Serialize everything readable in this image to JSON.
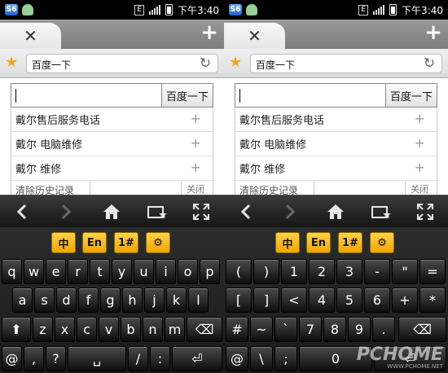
{
  "status_bar": {
    "app_badge": "S6",
    "network": "E",
    "time": "下午3:40"
  },
  "tab_strip": {
    "close_glyph": "✕",
    "add_glyph": "+"
  },
  "url_bar": {
    "value": "百度一下"
  },
  "search": {
    "value": "",
    "button_label": "百度一下"
  },
  "suggestions": [
    {
      "text": "戴尔售后服务电话"
    },
    {
      "text": "戴尔 电脑维修"
    },
    {
      "text": "戴尔 维修"
    }
  ],
  "suggestion_footer": {
    "clear_history": "清除历史记录",
    "close": "关闭"
  },
  "nav_bar": {
    "back": "back-icon",
    "forward": "forward-icon",
    "home": "home-icon",
    "bookmarks": "bookmarks-icon",
    "fullscreen": "fullscreen-icon"
  },
  "keyboard_left": {
    "mode_keys": [
      "中",
      "En",
      "1#",
      "⚙"
    ],
    "row1": [
      "q",
      "w",
      "e",
      "r",
      "t",
      "y",
      "u",
      "i",
      "o",
      "p"
    ],
    "row2": [
      "a",
      "s",
      "d",
      "f",
      "g",
      "h",
      "j",
      "k",
      "l"
    ],
    "row3": [
      "⬆",
      "z",
      "x",
      "c",
      "v",
      "b",
      "n",
      "m",
      "⌫"
    ],
    "row4": [
      "@",
      ",",
      "?",
      "␣",
      "/",
      ":",
      "⏎"
    ]
  },
  "keyboard_right": {
    "mode_keys": [
      "中",
      "En",
      "1#",
      "⚙"
    ],
    "row1": [
      "(",
      ")",
      "1",
      "2",
      "3",
      "-",
      "\"",
      "="
    ],
    "row2": [
      "[",
      "]",
      "<",
      "4",
      "5",
      "6",
      "+",
      "*"
    ],
    "row3": [
      "#",
      "~",
      "`",
      "7",
      "8",
      "9",
      ".",
      "⌫"
    ],
    "row4": [
      "@",
      "\\",
      ";",
      "0",
      "⏎"
    ]
  },
  "watermark": {
    "text": "PCHOME",
    "url": "WWW.PCHOME.NET"
  },
  "colors": {
    "accent": "#f0a500",
    "dark": "#1a1a1a",
    "star": "#f5a623"
  }
}
